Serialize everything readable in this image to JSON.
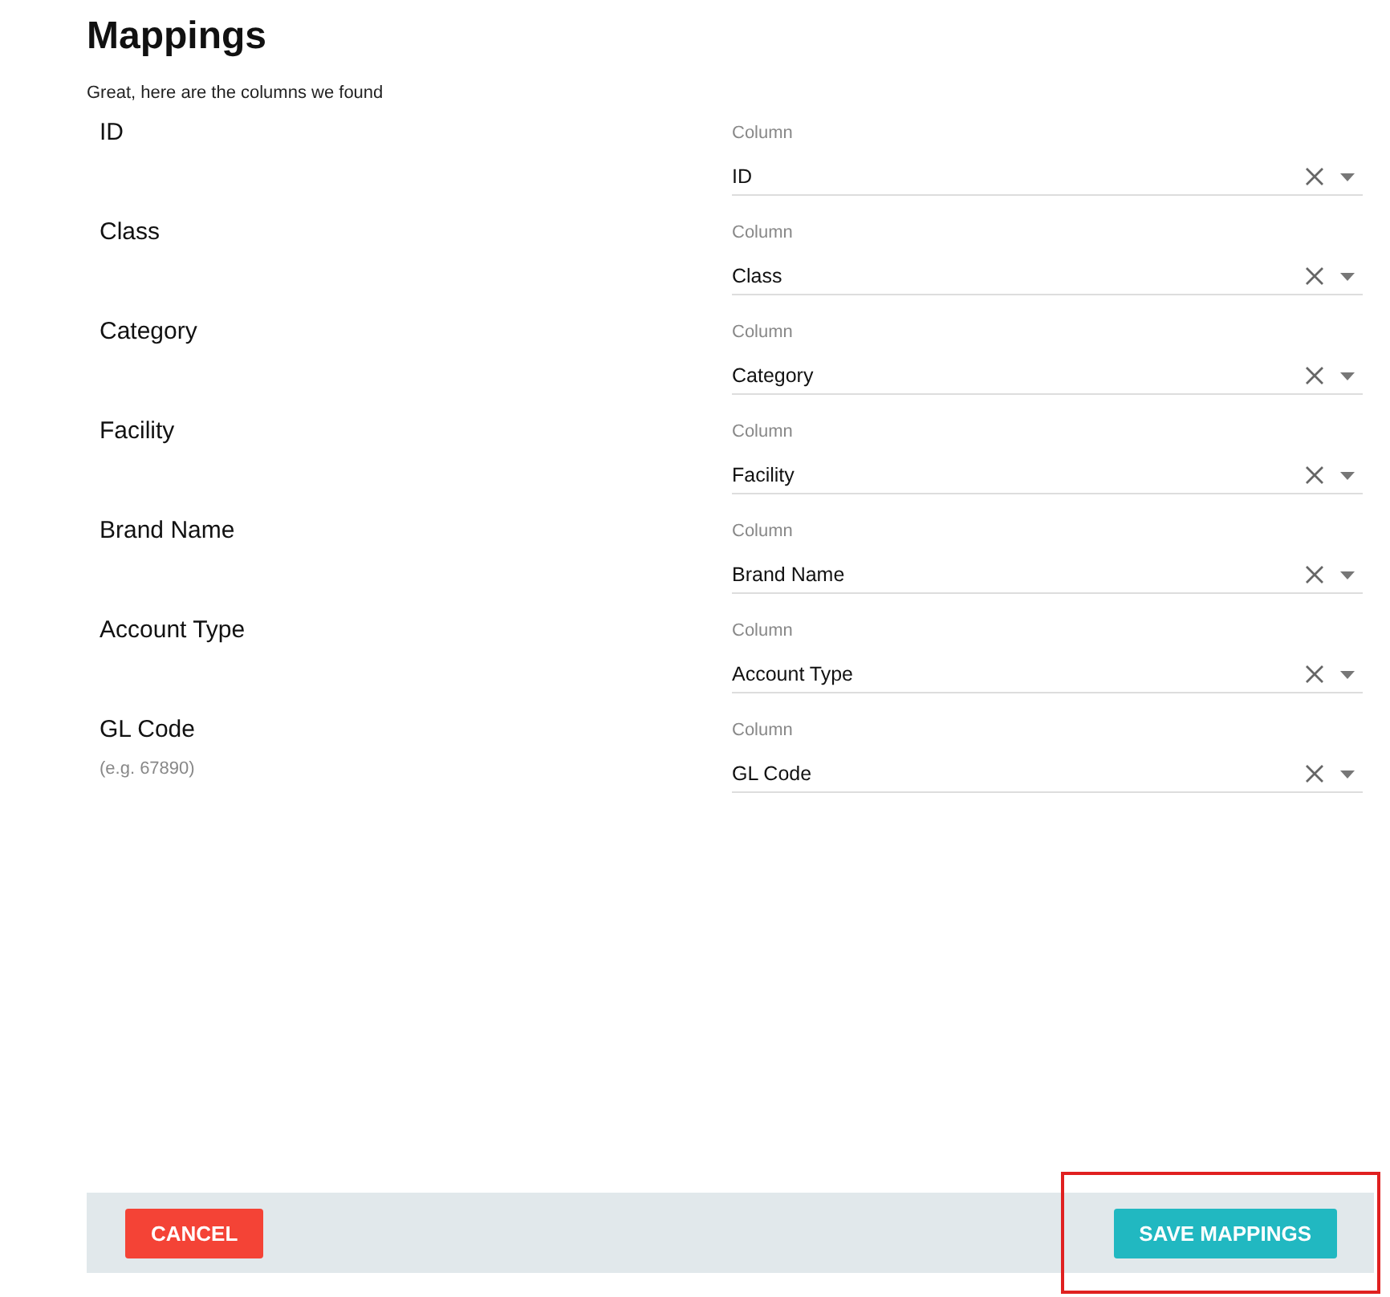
{
  "title": "Mappings",
  "subtitle": "Great, here are the columns we found",
  "mappings": [
    {
      "label": "ID",
      "field_label": "Column",
      "value": "ID"
    },
    {
      "label": "Class",
      "field_label": "Column",
      "value": "Class"
    },
    {
      "label": "Category",
      "field_label": "Column",
      "value": "Category"
    },
    {
      "label": "Facility",
      "field_label": "Column",
      "value": "Facility"
    },
    {
      "label": "Brand Name",
      "field_label": "Column",
      "value": "Brand Name"
    },
    {
      "label": "Account Type",
      "field_label": "Column",
      "value": "Account Type"
    },
    {
      "label": "GL Code",
      "hint": "(e.g. 67890)",
      "field_label": "Column",
      "value": "GL Code"
    }
  ],
  "buttons": [
    {
      "label": "CANCEL",
      "kind": "cancel"
    },
    {
      "label": "SAVE MAPPINGS",
      "kind": "save"
    }
  ]
}
